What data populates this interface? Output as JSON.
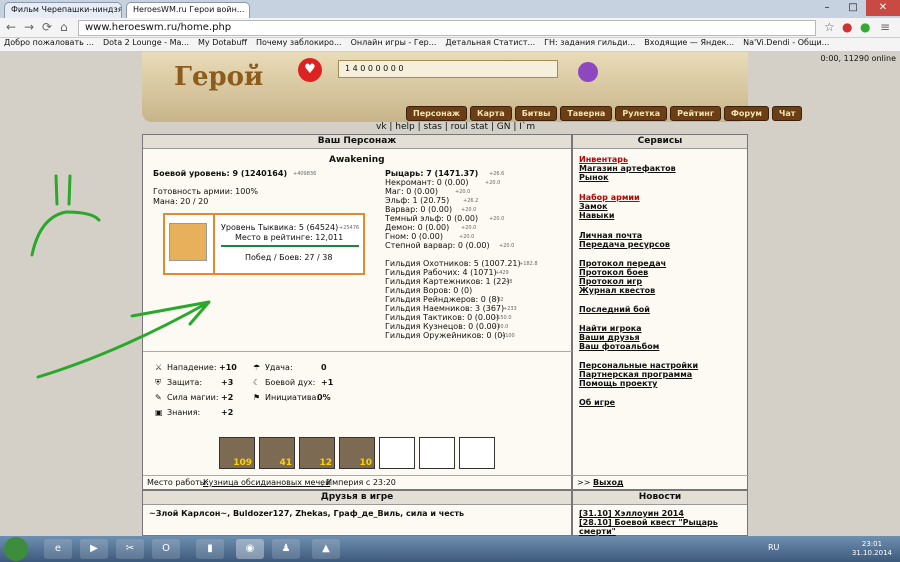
{
  "browser": {
    "tabs": [
      "Фильм Черепашки-ниндзя",
      "HeroesWM.ru Герои войн..."
    ],
    "url": "www.heroeswm.ru/home.php",
    "bookmarks": [
      "Добро пожаловать ...",
      "Dota 2 Lounge - Ma...",
      "My Dotabuff",
      "Почему заблокиро...",
      "Онлайн игры - Гер...",
      "Детальная Статист...",
      "ГН: задания гильди...",
      "Входящие — Яндек...",
      "Na'Vi.Dendi - Общи..."
    ]
  },
  "banner": {
    "logo": "Герой",
    "resources": "1 4 0 0 0 0 0 0",
    "time": "0:00, 11290 online",
    "menu": [
      "Персонаж",
      "Карта",
      "Битвы",
      "Таверна",
      "Рулетка",
      "Рейтинг",
      "Форум",
      "Чат"
    ],
    "links": "vk | help | stas | roul stat | GN | I`m"
  },
  "character": {
    "title": "Ваш Персонаж",
    "name": "Awakening",
    "combat_level": "Боевой уровень: 9 (1240164)",
    "combat_sub": "+409836",
    "army": "Готовность армии: 100%",
    "mana": "Мана: 20 / 20",
    "pumpkin_level": "Уровень Тыквика: 5 (64524)",
    "pumpkin_sub": "+25476",
    "rating": "Место в рейтинге: 12,011",
    "wins": "Побед / Боев: 27 / 38",
    "factions": [
      {
        "t": "Рыцарь: 7 (1471.37)",
        "s": "+26.6"
      },
      {
        "t": "Некромант: 0 (0.00)",
        "s": "+20.0"
      },
      {
        "t": "Маг: 0 (0.00)",
        "s": "+20.0"
      },
      {
        "t": "Эльф: 1 (20.75)",
        "s": "+26.2"
      },
      {
        "t": "Варвар: 0 (0.00)",
        "s": "+20.0"
      },
      {
        "t": "Темный эльф: 0 (0.00)",
        "s": "+20.0"
      },
      {
        "t": "Демон: 0 (0.00)",
        "s": "+20.0"
      },
      {
        "t": "Гном: 0 (0.00)",
        "s": "+20.0"
      },
      {
        "t": "Степной варвар: 0 (0.00)",
        "s": "+20.0"
      }
    ],
    "guilds": [
      {
        "t": "Гильдия Охотников: 5 (1007.21)",
        "s": "+182.8"
      },
      {
        "t": "Гильдия Рабочих: 4 (1071)",
        "s": "+429"
      },
      {
        "t": "Гильдия Картежников: 1 (22)",
        "s": "+8"
      },
      {
        "t": "Гильдия Воров: 0 (0)",
        "s": ""
      },
      {
        "t": "Гильдия Рейнджеров: 0 (8)",
        "s": "+92"
      },
      {
        "t": "Гильдия Наемников: 3 (367)",
        "s": "+233"
      },
      {
        "t": "Гильдия Тактиков: 0 (0.00)",
        "s": "+150.0"
      },
      {
        "t": "Гильдия Кузнецов: 0 (0.00)",
        "s": "+30.0"
      },
      {
        "t": "Гильдия Оружейников: 0 (0)",
        "s": "+100"
      }
    ],
    "stats": [
      {
        "label": "Нападение:",
        "value": "+10"
      },
      {
        "label": "Защита:",
        "value": "+3"
      },
      {
        "label": "Сила магии:",
        "value": "+2"
      },
      {
        "label": "Знания:",
        "value": "+2"
      }
    ],
    "stats2": [
      {
        "label": "Удача:",
        "value": "0"
      },
      {
        "label": "Боевой дух:",
        "value": "+1"
      },
      {
        "label": "Инициатива:",
        "value": "0%"
      }
    ],
    "army_counts": [
      "109",
      "41",
      "12",
      "10",
      "",
      "",
      ""
    ],
    "work_label": "Место работы:",
    "work_place": "Кузница обсидиановых мечей",
    "work_rest": ", Империя с 23:20"
  },
  "services": {
    "title": "Сервисы",
    "items": [
      "Инвентарь",
      "Магазин артефактов",
      "Рынок",
      "Набор армии",
      "Замок",
      "Навыки",
      "Личная почта",
      "Передача ресурсов",
      "Протокол передач",
      "Протокол боев",
      "Протокол игр",
      "Журнал квестов",
      "Последний бой",
      "Найти игрока",
      "Ваши друзья",
      "Ваш фотоальбом",
      "Персональные настройки",
      "Партнерская программа",
      "Помощь проекту",
      "Об игре"
    ],
    "logout_prefix": ">>",
    "logout": "Выход"
  },
  "friends": {
    "title": "Друзья в игре",
    "list": "~Злой Карлсон~, Buldozer127, Zhekas, Граф_де_Виль, сила и честь"
  },
  "news": {
    "title": "Новости",
    "items": [
      "[31.10] Хэллоуин 2014",
      "[28.10] Боевой квест \"Рыцарь смерти\""
    ]
  },
  "taskbar": {
    "lang": "RU",
    "time": "23:01",
    "date": "31.10.2014"
  }
}
